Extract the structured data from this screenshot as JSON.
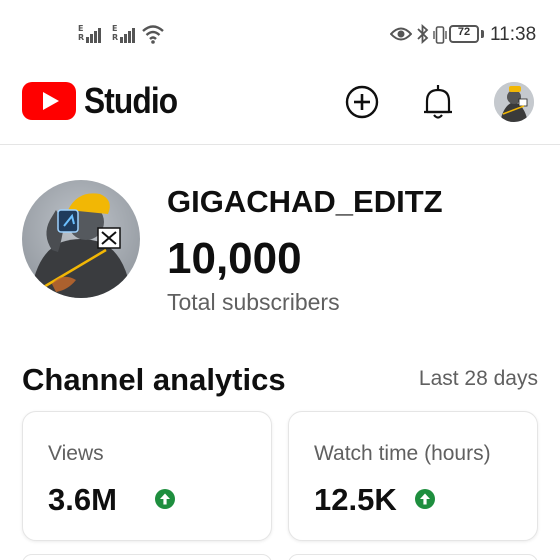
{
  "status_bar": {
    "signal1_tag": "E R",
    "signal2_tag": "E R",
    "battery_level": "72",
    "time": "11:38",
    "icons": [
      "signal-icon",
      "signal-icon",
      "wifi-icon",
      "eye-icon",
      "bluetooth-icon",
      "vibrate-icon",
      "battery-icon"
    ]
  },
  "header": {
    "logo_text": "Studio",
    "icons": [
      "youtube-logo-icon",
      "create-plus-icon",
      "notifications-bell-icon",
      "account-avatar"
    ]
  },
  "channel": {
    "name": "GIGACHAD_EDITZ",
    "subscribers": "10,000",
    "subscribers_label": "Total subscribers"
  },
  "analytics": {
    "title": "Channel analytics",
    "period": "Last 28 days",
    "cards": [
      {
        "label": "Views",
        "value": "3.6M",
        "trend": "up"
      },
      {
        "label": "Watch time (hours)",
        "value": "12.5K",
        "trend": "up"
      }
    ]
  },
  "colors": {
    "brand_red": "#ff0000",
    "trend_up_green": "#1e8e3e",
    "text_primary": "#0f0f0f",
    "text_secondary": "#606060"
  }
}
